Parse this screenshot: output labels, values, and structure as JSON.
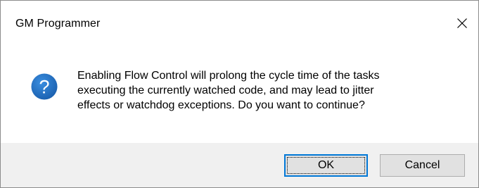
{
  "window": {
    "title": "GM Programmer",
    "close_icon": "close-icon"
  },
  "dialog": {
    "icon": "question-icon",
    "icon_glyph": "?",
    "message": "Enabling Flow Control will prolong the cycle time of the tasks\nexecuting the currently watched code, and may lead to jitter\neffects or watchdog exceptions. Do you want to continue?"
  },
  "buttons": {
    "ok_label": "OK",
    "cancel_label": "Cancel"
  },
  "colors": {
    "icon_blue": "#1f6fc4",
    "focus_blue": "#0078d7",
    "footer_bg": "#f0f0f0",
    "button_bg": "#e1e1e1"
  }
}
